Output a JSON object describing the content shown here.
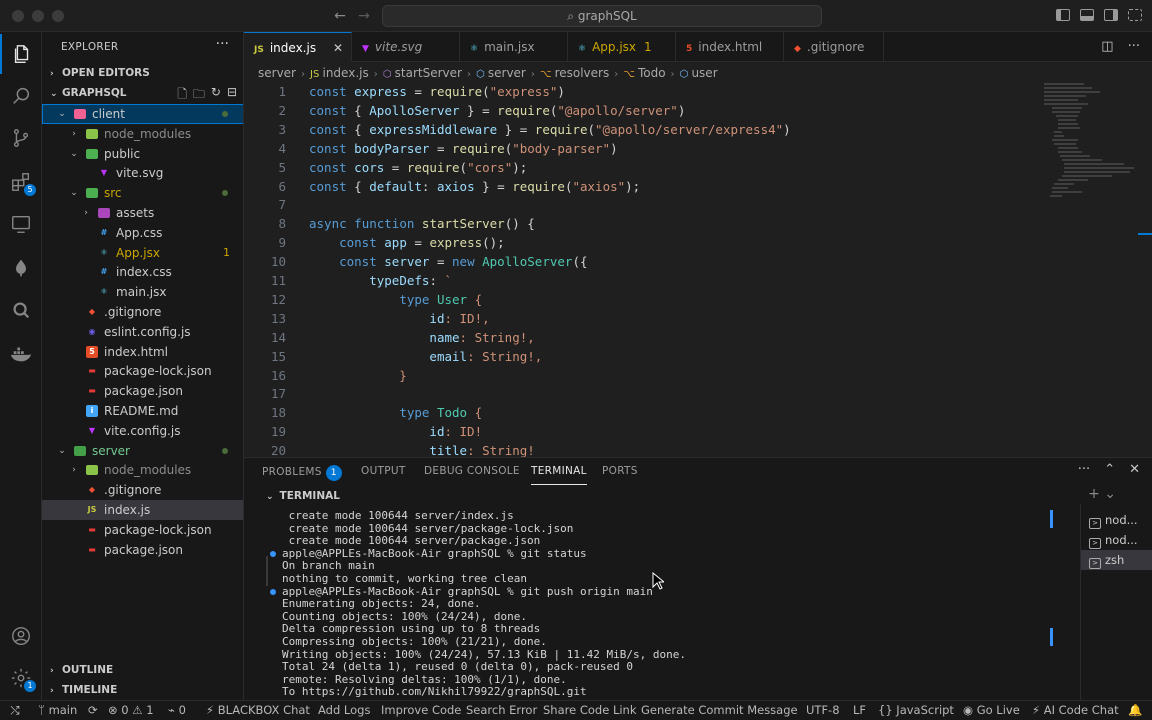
{
  "window": {
    "command_center": "graphSQL"
  },
  "activity_bar": {
    "items": [
      {
        "name": "explorer-icon"
      },
      {
        "name": "search-icon"
      },
      {
        "name": "source-control-icon"
      },
      {
        "name": "extensions-icon",
        "badge": "5"
      },
      {
        "name": "remote-explorer-icon"
      },
      {
        "name": "mongodb-icon"
      },
      {
        "name": "graphql-icon"
      },
      {
        "name": "docker-icon"
      }
    ],
    "account_icon": "account-icon",
    "settings_badge": "1"
  },
  "sidebar": {
    "title": "EXPLORER",
    "open_editors": "OPEN EDITORS",
    "workspace": "GRAPHSQL",
    "tree": [
      {
        "label": "client",
        "depth": 0,
        "kind": "folder-open",
        "selected": true,
        "dot": true,
        "color": "#cccccc"
      },
      {
        "label": "node_modules",
        "depth": 1,
        "kind": "folder-closed",
        "color": "#8c8c8c"
      },
      {
        "label": "public",
        "depth": 1,
        "kind": "folder-open",
        "color": "#cccccc"
      },
      {
        "label": "vite.svg",
        "depth": 2,
        "kind": "file",
        "icon": "vite",
        "color": "#cccccc"
      },
      {
        "label": "src",
        "depth": 1,
        "kind": "folder-open",
        "dot": true,
        "color": "#cca700"
      },
      {
        "label": "assets",
        "depth": 2,
        "kind": "folder-closed",
        "color": "#cccccc"
      },
      {
        "label": "App.css",
        "depth": 2,
        "kind": "file",
        "icon": "css",
        "color": "#cccccc"
      },
      {
        "label": "App.jsx",
        "depth": 2,
        "kind": "file",
        "icon": "react",
        "count": "1",
        "color": "#cca700"
      },
      {
        "label": "index.css",
        "depth": 2,
        "kind": "file",
        "icon": "css",
        "color": "#cccccc"
      },
      {
        "label": "main.jsx",
        "depth": 2,
        "kind": "file",
        "icon": "react",
        "color": "#cccccc"
      },
      {
        "label": ".gitignore",
        "depth": 1,
        "kind": "file",
        "icon": "git",
        "color": "#cccccc"
      },
      {
        "label": "eslint.config.js",
        "depth": 1,
        "kind": "file",
        "icon": "eslint",
        "color": "#cccccc"
      },
      {
        "label": "index.html",
        "depth": 1,
        "kind": "file",
        "icon": "html",
        "color": "#cccccc"
      },
      {
        "label": "package-lock.json",
        "depth": 1,
        "kind": "file",
        "icon": "npm",
        "color": "#cccccc"
      },
      {
        "label": "package.json",
        "depth": 1,
        "kind": "file",
        "icon": "npm",
        "color": "#cccccc"
      },
      {
        "label": "README.md",
        "depth": 1,
        "kind": "file",
        "icon": "info",
        "color": "#cccccc"
      },
      {
        "label": "vite.config.js",
        "depth": 1,
        "kind": "file",
        "icon": "vite",
        "color": "#cccccc"
      },
      {
        "label": "server",
        "depth": 0,
        "kind": "folder-open",
        "dot": true,
        "color": "#73c991"
      },
      {
        "label": "node_modules",
        "depth": 1,
        "kind": "folder-closed",
        "color": "#8c8c8c"
      },
      {
        "label": ".gitignore",
        "depth": 1,
        "kind": "file",
        "icon": "git",
        "color": "#cccccc"
      },
      {
        "label": "index.js",
        "depth": 1,
        "kind": "file",
        "icon": "js",
        "active": true,
        "color": "#cccccc"
      },
      {
        "label": "package-lock.json",
        "depth": 1,
        "kind": "file",
        "icon": "npm",
        "color": "#cccccc"
      },
      {
        "label": "package.json",
        "depth": 1,
        "kind": "file",
        "icon": "npm",
        "color": "#cccccc"
      }
    ],
    "outline": "OUTLINE",
    "timeline": "TIMELINE"
  },
  "tabs": [
    {
      "label": "index.js",
      "icon": "JS",
      "active": true
    },
    {
      "label": "vite.svg",
      "icon": "vite"
    },
    {
      "label": "main.jsx",
      "icon": "react"
    },
    {
      "label": "App.jsx",
      "icon": "react",
      "count": "1"
    },
    {
      "label": "index.html",
      "icon": "html"
    },
    {
      "label": ".gitignore",
      "icon": "git"
    }
  ],
  "breadcrumbs": [
    "server",
    "index.js",
    "startServer",
    "server",
    "resolvers",
    "Todo",
    "user"
  ],
  "editor": {
    "lines": [
      [
        [
          "kw",
          "const"
        ],
        [
          "pun",
          " "
        ],
        [
          "var",
          "express"
        ],
        [
          "pun",
          " = "
        ],
        [
          "fn",
          "require"
        ],
        [
          "pun",
          "("
        ],
        [
          "str",
          "\"express\""
        ],
        [
          "pun",
          ")"
        ]
      ],
      [
        [
          "kw",
          "const"
        ],
        [
          "pun",
          " { "
        ],
        [
          "var",
          "ApolloServer"
        ],
        [
          "pun",
          " } = "
        ],
        [
          "fn",
          "require"
        ],
        [
          "pun",
          "("
        ],
        [
          "str",
          "\"@apollo/server\""
        ],
        [
          "pun",
          ")"
        ]
      ],
      [
        [
          "kw",
          "const"
        ],
        [
          "pun",
          " { "
        ],
        [
          "var",
          "expressMiddleware"
        ],
        [
          "pun",
          " } = "
        ],
        [
          "fn",
          "require"
        ],
        [
          "pun",
          "("
        ],
        [
          "str",
          "\"@apollo/server/express4\""
        ],
        [
          "pun",
          ")"
        ]
      ],
      [
        [
          "kw",
          "const"
        ],
        [
          "pun",
          " "
        ],
        [
          "var",
          "bodyParser"
        ],
        [
          "pun",
          " = "
        ],
        [
          "fn",
          "require"
        ],
        [
          "pun",
          "("
        ],
        [
          "str",
          "\"body-parser\""
        ],
        [
          "pun",
          ")"
        ]
      ],
      [
        [
          "kw",
          "const"
        ],
        [
          "pun",
          " "
        ],
        [
          "var",
          "cors"
        ],
        [
          "pun",
          " = "
        ],
        [
          "fn",
          "require"
        ],
        [
          "pun",
          "("
        ],
        [
          "str",
          "\"cors\""
        ],
        [
          "pun",
          ");"
        ]
      ],
      [
        [
          "kw",
          "const"
        ],
        [
          "pun",
          " { "
        ],
        [
          "var",
          "default"
        ],
        [
          "pun",
          ": "
        ],
        [
          "var",
          "axios"
        ],
        [
          "pun",
          " } = "
        ],
        [
          "fn",
          "require"
        ],
        [
          "pun",
          "("
        ],
        [
          "str",
          "\"axios\""
        ],
        [
          "pun",
          ");"
        ]
      ],
      [],
      [
        [
          "kw",
          "async"
        ],
        [
          "pun",
          " "
        ],
        [
          "kw",
          "function"
        ],
        [
          "pun",
          " "
        ],
        [
          "fn",
          "startServer"
        ],
        [
          "pun",
          "() {"
        ]
      ],
      [
        [
          "pun",
          "    "
        ],
        [
          "kw",
          "const"
        ],
        [
          "pun",
          " "
        ],
        [
          "var",
          "app"
        ],
        [
          "pun",
          " = "
        ],
        [
          "fn",
          "express"
        ],
        [
          "pun",
          "();"
        ]
      ],
      [
        [
          "pun",
          "    "
        ],
        [
          "kw",
          "const"
        ],
        [
          "pun",
          " "
        ],
        [
          "var",
          "server"
        ],
        [
          "pun",
          " = "
        ],
        [
          "kw",
          "new"
        ],
        [
          "pun",
          " "
        ],
        [
          "cls",
          "ApolloServer"
        ],
        [
          "pun",
          "({"
        ]
      ],
      [
        [
          "pun",
          "        "
        ],
        [
          "var",
          "typeDefs"
        ],
        [
          "pun",
          ": "
        ],
        [
          "tmpl",
          "`"
        ]
      ],
      [
        [
          "tmpl",
          "            "
        ],
        [
          "kw",
          "type"
        ],
        [
          "tmpl",
          " "
        ],
        [
          "cls",
          "User"
        ],
        [
          "tmpl",
          " {"
        ]
      ],
      [
        [
          "tmpl",
          "                "
        ],
        [
          "var",
          "id"
        ],
        [
          "tmpl",
          ": ID!,"
        ]
      ],
      [
        [
          "tmpl",
          "                "
        ],
        [
          "var",
          "name"
        ],
        [
          "tmpl",
          ": String!,"
        ]
      ],
      [
        [
          "tmpl",
          "                "
        ],
        [
          "var",
          "email"
        ],
        [
          "tmpl",
          ": String!,"
        ]
      ],
      [
        [
          "tmpl",
          "            }"
        ]
      ],
      [],
      [
        [
          "tmpl",
          "            "
        ],
        [
          "kw",
          "type"
        ],
        [
          "tmpl",
          " "
        ],
        [
          "cls",
          "Todo"
        ],
        [
          "tmpl",
          " {"
        ]
      ],
      [
        [
          "tmpl",
          "                "
        ],
        [
          "var",
          "id"
        ],
        [
          "tmpl",
          ": ID!"
        ]
      ],
      [
        [
          "tmpl",
          "                "
        ],
        [
          "var",
          "title"
        ],
        [
          "tmpl",
          ": String!"
        ]
      ]
    ]
  },
  "panel": {
    "tabs": [
      {
        "label": "PROBLEMS",
        "badge": "1"
      },
      {
        "label": "OUTPUT"
      },
      {
        "label": "DEBUG CONSOLE"
      },
      {
        "label": "TERMINAL",
        "active": true
      },
      {
        "label": "PORTS"
      }
    ],
    "terminal_header": "TERMINAL",
    "terminal_lines": [
      {
        "text": " create mode 100644 server/index.js",
        "dot": false
      },
      {
        "text": " create mode 100644 server/package-lock.json",
        "dot": false
      },
      {
        "text": " create mode 100644 server/package.json",
        "dot": false
      },
      {
        "text": "apple@APPLEs-MacBook-Air graphSQL % git status",
        "dot": true
      },
      {
        "text": "On branch main",
        "dot": false
      },
      {
        "text": "nothing to commit, working tree clean",
        "dot": false
      },
      {
        "text": "apple@APPLEs-MacBook-Air graphSQL % git push origin main",
        "dot": true
      },
      {
        "text": "Enumerating objects: 24, done.",
        "dot": false
      },
      {
        "text": "Counting objects: 100% (24/24), done.",
        "dot": false
      },
      {
        "text": "Delta compression using up to 8 threads",
        "dot": false
      },
      {
        "text": "Compressing objects: 100% (21/21), done.",
        "dot": false
      },
      {
        "text": "Writing objects: 100% (24/24), 57.13 KiB | 11.42 MiB/s, done.",
        "dot": false
      },
      {
        "text": "Total 24 (delta 1), reused 0 (delta 0), pack-reused 0",
        "dot": false
      },
      {
        "text": "remote: Resolving deltas: 100% (1/1), done.",
        "dot": false
      },
      {
        "text": "To https://github.com/Nikhil79922/graphSQL.git",
        "dot": false
      }
    ],
    "terminal_list": [
      "nod...",
      "nod...",
      "zsh"
    ]
  },
  "statusbar": {
    "branch": "main",
    "errors": "0",
    "warnings": "1",
    "ports": "0",
    "items_left": [
      "BLACKBOX Chat",
      "Add Logs",
      "Improve Code",
      "Search Error",
      "Share Code Link",
      "Generate Commit Message"
    ],
    "encoding": "UTF-8",
    "eol": "LF",
    "braces": "{}",
    "language": "JavaScript",
    "golive": "Go Live",
    "ai": "AI Code Chat"
  },
  "colors": {
    "accent": "#0078d4",
    "warning": "#cca700",
    "git_added": "#73c991"
  }
}
